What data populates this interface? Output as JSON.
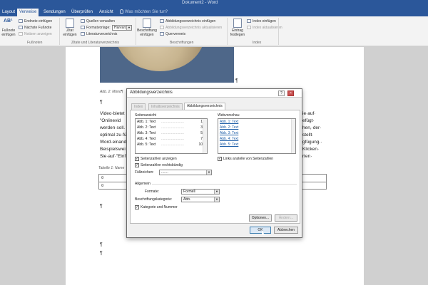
{
  "window": {
    "title": "Dokument2 - Word"
  },
  "tabs": [
    "Layout",
    "Verweise",
    "Sendungen",
    "Überprüfen",
    "Ansicht"
  ],
  "tell_me": "Was möchten Sie tun?",
  "ribbon": {
    "footnotes": {
      "big_button": "Fußnote einfügen",
      "ab_icon": "AB¹",
      "items": [
        "Endnote einfügen",
        "Nächste Fußnote",
        "Notizen anzeigen"
      ],
      "group_label": "Fußnoten"
    },
    "citations": {
      "big_button": "Zitat einfügen",
      "items": [
        "Quellen verwalten",
        "Formatvorlage:",
        "Literaturverzeichnis"
      ],
      "style_value": "Harvard",
      "group_label": "Zitate und Literaturverzeichnis"
    },
    "captions": {
      "big_button": "Beschriftung einfügen",
      "items": [
        "Abbildungsverzeichnis einfügen",
        "Abbildungsverzeichnis aktualisieren",
        "Querverweis"
      ],
      "group_label": "Beschriftungen"
    },
    "index": {
      "big_button": "Eintrag festlegen",
      "items": [
        "Index einfügen",
        "Index aktualisieren"
      ],
      "group_label": "Index"
    }
  },
  "document": {
    "pilcrow": "¶",
    "figure_caption": "Abb. 2: Mond¶",
    "table_caption": "Tabelle 1: Name",
    "body_left": [
      "Video·bietet",
      "\"Onlinevid",
      "werden·soll.",
      "optimal·zu·fü",
      "Word·einanda",
      "Beispielswei",
      "Sie·auf·\"Einf"
    ],
    "body_right": [
      "ie·auf·",
      "efügt·",
      "hen,·der·",
      "stellt·",
      "gfügung.·",
      "Klicken·",
      "rten·"
    ],
    "table_cell": "¤"
  },
  "dialog": {
    "title": "Abbildungsverzeichnis",
    "help": "?",
    "close": "×",
    "tabs": [
      "Index",
      "Inhaltsverzeichnis",
      "Abbildungsverzeichnis"
    ],
    "active_tab": "Abbildungsverzeichnis",
    "print_preview_label": "Seitenansicht",
    "print_preview_rows": [
      {
        "label": "Abb. 1: Text",
        "page": "1"
      },
      {
        "label": "Abb. 2: Text",
        "page": "3"
      },
      {
        "label": "Abb. 3: Text",
        "page": "5"
      },
      {
        "label": "Abb. 4: Text",
        "page": "7"
      },
      {
        "label": "Abb. 5: Text",
        "page": "10"
      }
    ],
    "web_preview_label": "Webvorschau",
    "web_preview_rows": [
      "Abb. 1: Text",
      "Abb. 2: Text",
      "Abb. 3: Text",
      "Abb. 4: Text",
      "Abb. 5: Text"
    ],
    "show_page_numbers": "Seitenzahlen anzeigen",
    "right_align_page_numbers": "Seitenzahlen rechtsbündig",
    "tab_leader_label": "Füllzeichen:",
    "tab_leader_value": ".......",
    "use_hyperlinks": "Links anstelle von Seitenzahlen",
    "general_label": "Allgemein",
    "formats_label": "Formate:",
    "formats_value": "Formell",
    "caption_label": "Beschriftungskategorie:",
    "caption_value": "Abb.",
    "include_label_number": "Kategorie und Nummer",
    "options_button": "Optionen...",
    "modify_button": "Ändern...",
    "ok_button": "OK",
    "cancel_button": "Abbrechen"
  }
}
